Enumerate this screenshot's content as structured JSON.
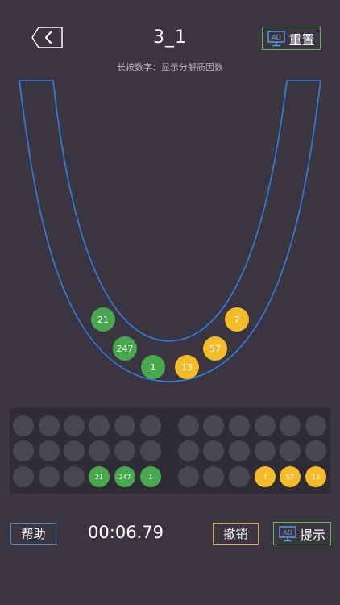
{
  "header": {
    "title": "3_1",
    "reset_label": "重置",
    "ad_badge": "AD"
  },
  "subtitle": "长按数字：显示分解质因数",
  "play_area": {
    "green_balls": [
      "21",
      "247",
      "1"
    ],
    "yellow_balls": [
      "13",
      "57",
      "7"
    ]
  },
  "tray": {
    "rows": [
      [
        "",
        "",
        "",
        "",
        "",
        "",
        "",
        "",
        "",
        "",
        "",
        ""
      ],
      [
        "",
        "",
        "",
        "",
        "",
        "",
        "",
        "",
        "",
        "",
        "",
        ""
      ],
      [
        "",
        "",
        "",
        "21",
        "247",
        "1",
        "",
        "",
        "",
        "7",
        "57",
        "13"
      ]
    ],
    "colors": [
      [
        "",
        "",
        "",
        "",
        "",
        "",
        "",
        "",
        "",
        "",
        "",
        ""
      ],
      [
        "",
        "",
        "",
        "",
        "",
        "",
        "",
        "",
        "",
        "",
        "",
        ""
      ],
      [
        "",
        "",
        "",
        "green",
        "green",
        "green",
        "",
        "",
        "",
        "yellow",
        "yellow",
        "yellow"
      ]
    ]
  },
  "footer": {
    "help_label": "帮助",
    "timer": "00:06.79",
    "undo_label": "撤销",
    "hint_label": "提示"
  },
  "colors": {
    "background": "#3a3541",
    "tube_stroke": "#2f7fe0",
    "green_ball": "#47a84e",
    "yellow_ball": "#f5bc2a",
    "ad_border": "#5fc052",
    "help_border": "#4f86c6",
    "undo_border": "#e3a533"
  }
}
